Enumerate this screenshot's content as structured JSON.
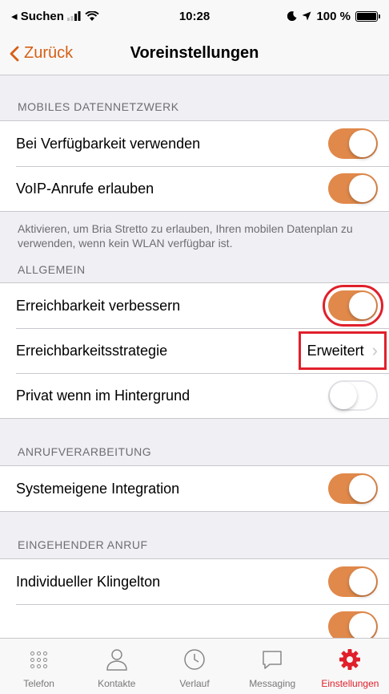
{
  "status_bar": {
    "carrier": "◂ Suchen",
    "time": "10:28",
    "battery_text": "100 %"
  },
  "nav": {
    "back_label": "Zurück",
    "title": "Voreinstellungen"
  },
  "colors": {
    "accent": "#d65f16",
    "toggle_on": "#e0894b",
    "highlight": "#e0202a"
  },
  "sections": {
    "mobile": {
      "header": "MOBILES DATENNETZWERK",
      "rows": [
        {
          "label": "Bei Verfügbarkeit verwenden",
          "toggle": true
        },
        {
          "label": "VoIP-Anrufe erlauben",
          "toggle": true
        }
      ],
      "footer": "Aktivieren, um Bria Stretto zu erlauben, Ihren mobilen Datenplan zu verwenden, wenn kein WLAN verfügbar ist."
    },
    "general": {
      "header": "ALLGEMEIN",
      "rows": [
        {
          "label": "Erreichbarkeit verbessern",
          "toggle": true
        },
        {
          "label": "Erreichbarkeitsstrategie",
          "value": "Erweitert"
        },
        {
          "label": "Privat wenn im Hintergrund",
          "toggle": false
        }
      ]
    },
    "call_processing": {
      "header": "ANRUFVERARBEITUNG",
      "rows": [
        {
          "label": "Systemeigene Integration",
          "toggle": true
        }
      ]
    },
    "incoming": {
      "header": "EINGEHENDER ANRUF",
      "rows": [
        {
          "label": "Individueller Klingelton",
          "toggle": true
        }
      ]
    }
  },
  "tabs": [
    {
      "label": "Telefon",
      "icon": "keypad-icon",
      "active": false
    },
    {
      "label": "Kontakte",
      "icon": "contacts-icon",
      "active": false
    },
    {
      "label": "Verlauf",
      "icon": "clock-icon",
      "active": false
    },
    {
      "label": "Messaging",
      "icon": "chat-bubble-icon",
      "active": false
    },
    {
      "label": "Einstellungen",
      "icon": "gear-icon",
      "active": true
    }
  ]
}
